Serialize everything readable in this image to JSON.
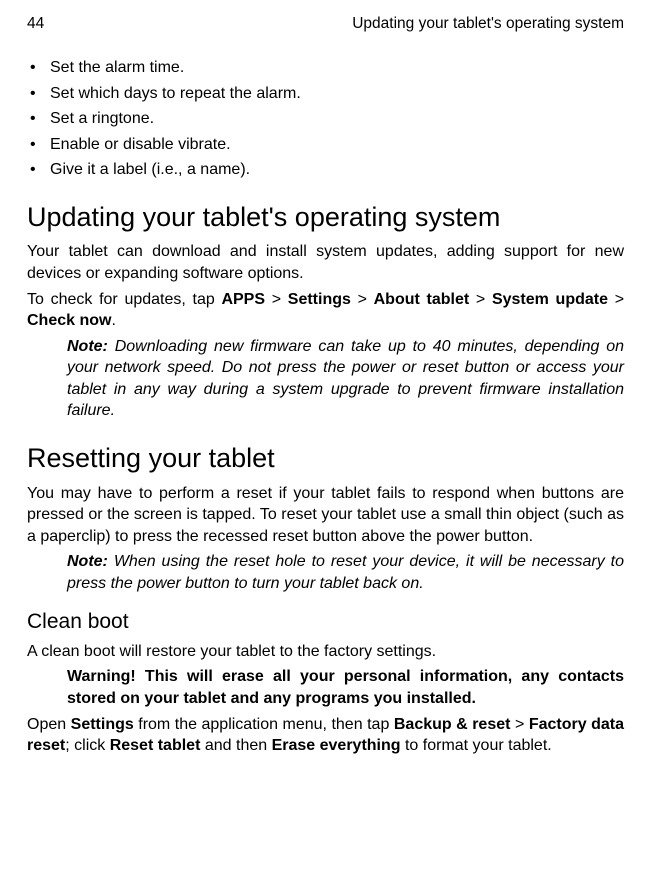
{
  "header": {
    "page_number": "44",
    "chapter_title": "Updating your tablet's operating system"
  },
  "alarm_bullets": [
    "Set the alarm time.",
    "Set which days to repeat the alarm.",
    "Set a ringtone.",
    "Enable or disable vibrate.",
    "Give it a label (i.e., a name)."
  ],
  "section_updating": {
    "heading": "Updating your tablet's operating system",
    "p1": "Your tablet can download and install system updates, adding support for new devices or expanding software options.",
    "p2_pre": "To check for updates, tap ",
    "p2_app": "APPS",
    "p2_gt1": " > ",
    "p2_settings": "Settings",
    "p2_gt2": " > ",
    "p2_about": "About tablet",
    "p2_gt3": " > ",
    "p2_system": "System update",
    "p2_gt4": " > ",
    "p2_check": "Check now",
    "p2_dot": ".",
    "note_label": "Note:",
    "note_text": " Downloading new firmware can take up to 40 minutes, depending on your network speed. Do not press the power or reset button or access your tablet in any way during a system upgrade to prevent firmware installation failure."
  },
  "section_resetting": {
    "heading": "Resetting your tablet",
    "p1": "You may have to perform a reset if your tablet fails to respond when buttons are pressed or the screen is tapped. To reset your tablet use a small thin object (such as a paperclip) to press the recessed reset button above the power button.",
    "note_label": "Note:",
    "note_text": " When using the reset hole to reset your device, it will be necessary to press the power button to turn your tablet back on."
  },
  "section_cleanboot": {
    "heading": "Clean boot",
    "p1": "A clean boot will restore your tablet to the factory settings.",
    "warning": "Warning! This will erase all your personal information, any contacts stored on your tablet and any programs you installed.",
    "p2_open": "Open ",
    "p2_settings": "Settings",
    "p2_mid1": " from the application menu, then tap ",
    "p2_backup": "Backup & reset",
    "p2_gt": " > ",
    "p2_factory": "Factory data reset",
    "p2_mid2": "; click ",
    "p2_reset": "Reset tablet",
    "p2_mid3": " and then ",
    "p2_erase": "Erase everything",
    "p2_end": " to format your tablet."
  }
}
